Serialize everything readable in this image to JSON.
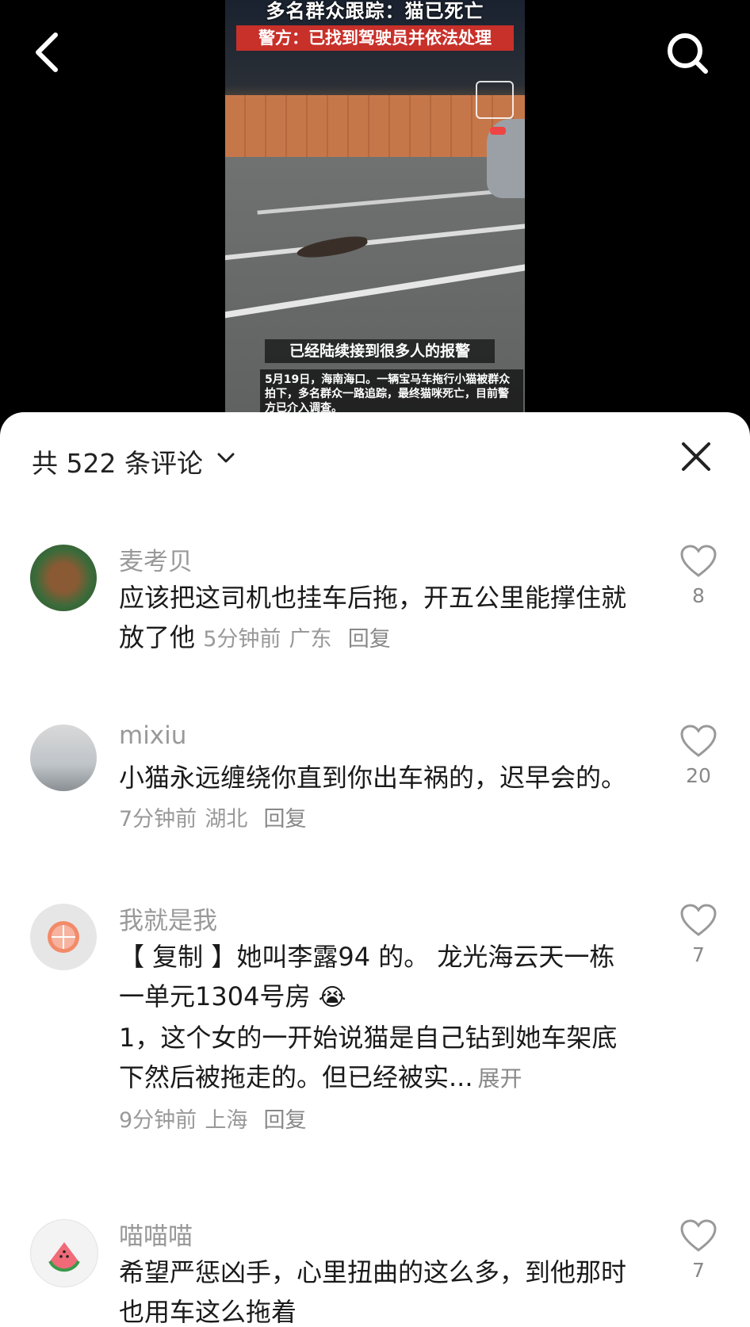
{
  "video": {
    "title_line1": "多名群众跟踪：猫已死亡",
    "title_line2": "警方：已找到驾驶员并依法处理",
    "subtitle": "已经陆续接到很多人的报警",
    "caption": "5月19日，海南海口。一辆宝马车拖行小猫被群众拍下，多名群众一路追踪，最终猫咪死亡，目前警方已介入调查。"
  },
  "nav": {
    "back_icon": "chevron-left-icon",
    "search_icon": "search-icon"
  },
  "sheet": {
    "comment_count_label": "共 522 条评论",
    "close_icon": "close-icon"
  },
  "comments": [
    {
      "username": "麦考贝",
      "text": "应该把这司机也挂车后拖，开五公里能撑住就放了他",
      "time": "5分钟前",
      "location": "广东",
      "reply_label": "回复",
      "likes": "8"
    },
    {
      "username": "mixiu",
      "text": "小猫永远缠绕你直到你出车祸的，迟早会的。",
      "time": "7分钟前",
      "location": "湖北",
      "reply_label": "回复",
      "likes": "20"
    },
    {
      "username": "我就是我",
      "text_line1": "【 复制 】她叫李露94 的。 龙光海云天一栋一单元1304号房",
      "text_line2": "1，这个女的一开始说猫是自己钻到她车架底下然后被拖走的。但已经被实...",
      "expand_label": "展开",
      "time": "9分钟前",
      "location": "上海",
      "reply_label": "回复",
      "likes": "7"
    },
    {
      "username": "喵喵喵",
      "text": "希望严惩凶手，心里扭曲的这么多，到他那时也用车这么拖着",
      "likes": "7"
    }
  ]
}
